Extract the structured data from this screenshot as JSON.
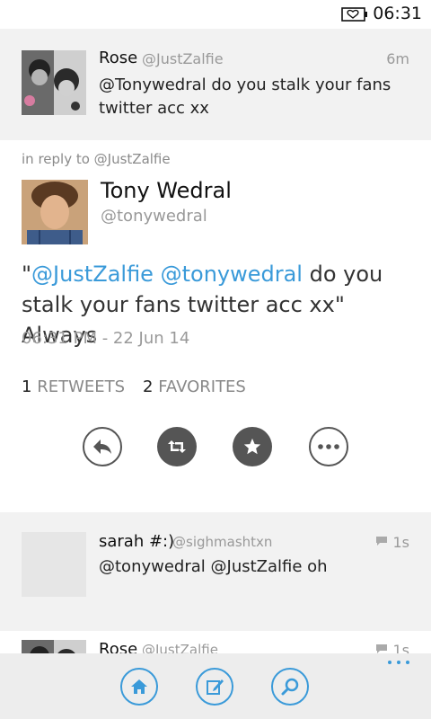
{
  "status": {
    "time": "06:31"
  },
  "parent": {
    "name": "Rose",
    "handle": "@JustZalfie",
    "time": "6m",
    "text": "@Tonywedral do you stalk your fans twitter acc xx"
  },
  "reply_to": "in reply to @JustZalfie",
  "main": {
    "name": "Tony Wedral",
    "handle": "@tonywedral",
    "text_parts": {
      "quote_open": "\"",
      "mention1": "@JustZalfie",
      "mention2": "@tonywedral",
      "rest": " do you stalk your fans twitter acc xx\" Always"
    },
    "date": "06:31 PM - 22 Jun 14",
    "retweets_count": "1",
    "retweets_label": "RETWEETS",
    "favorites_count": "2",
    "favorites_label": "FAVORITES"
  },
  "replies": [
    {
      "name": "sarah #:)",
      "handle": "@sighmashtxn",
      "time": "1s",
      "text": "@tonywedral @JustZalfie oh"
    },
    {
      "name": "Rose",
      "handle": "@JustZalfie",
      "time": "1s"
    }
  ],
  "colors": {
    "accent": "#3a9ad9",
    "icon_dark": "#555555",
    "panel": "#f2f2f2"
  }
}
